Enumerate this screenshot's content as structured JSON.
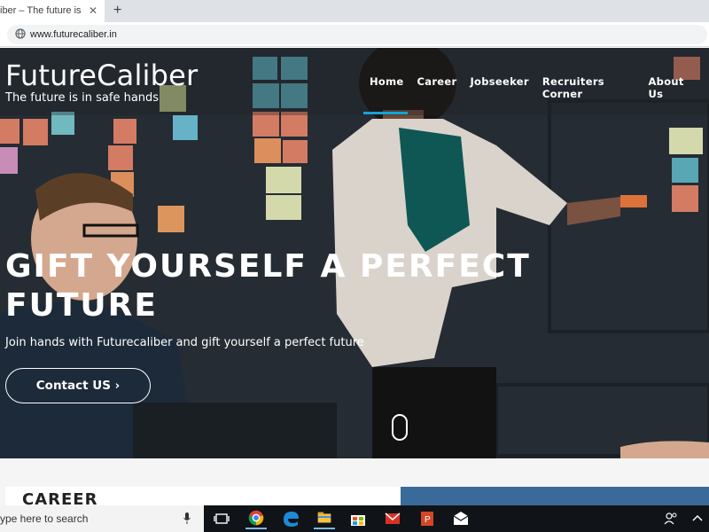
{
  "browser": {
    "tab_title": "iber – The future is in sa",
    "tab_close": "✕",
    "new_tab": "+",
    "url": "www.futurecaliber.in"
  },
  "site": {
    "brand": "FutureCaliber",
    "tagline": "The future is in safe hands",
    "nav": [
      "Home",
      "Career",
      "Jobseeker",
      "Recruiters Corner",
      "About Us"
    ],
    "active_nav": "Home",
    "hero": {
      "headline_line1": "GIFT YOURSELF A PERFECT",
      "headline_line2": "FUTURE",
      "subline": "Join hands with Futurecaliber and gift yourself a perfect future",
      "cta_label": "Contact US ›"
    },
    "section_title": "CAREER"
  },
  "taskbar": {
    "search_placeholder": "ype here to search",
    "apps": [
      "task-view",
      "chrome",
      "edge",
      "file-explorer",
      "store",
      "mail-red",
      "powerpoint",
      "mail"
    ]
  },
  "colors": {
    "accent": "#14a3d6",
    "taskbar": "#101318"
  }
}
